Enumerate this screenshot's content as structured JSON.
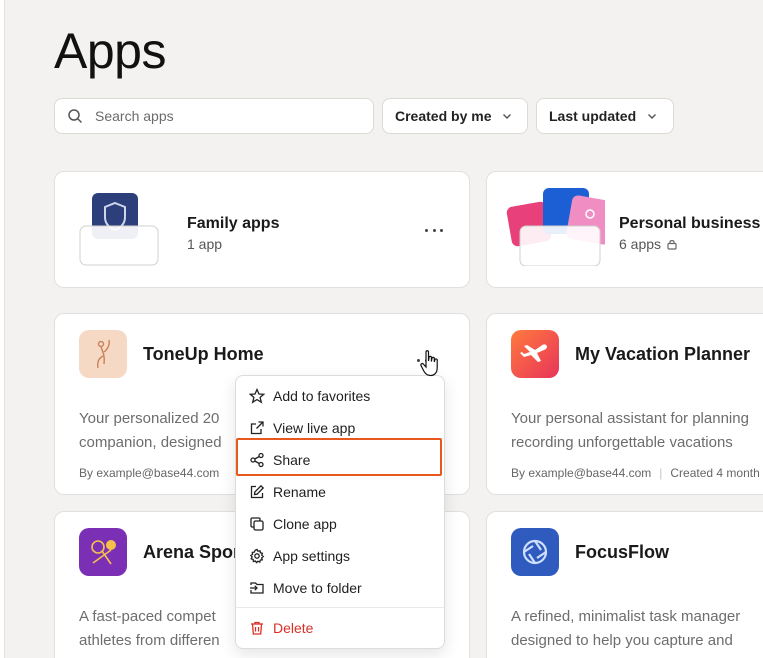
{
  "page": {
    "title": "Apps"
  },
  "filters": {
    "search_placeholder": "Search apps",
    "created_by": "Created by me",
    "sort": "Last updated"
  },
  "folders": [
    {
      "name": "Family apps",
      "count": "1 app",
      "locked": false
    },
    {
      "name": "Personal business",
      "count": "6 apps",
      "locked": true
    }
  ],
  "apps": [
    {
      "name": "ToneUp Home",
      "icon": "fitness-figure-icon",
      "icon_color": "#f6d9c4",
      "desc_lines": [
        "Your personalized 20",
        "companion, designed"
      ],
      "author": "By example@base44.com",
      "created": ""
    },
    {
      "name": "My Vacation Planner",
      "icon": "airplane-icon",
      "icon_color": "#f2553f",
      "desc_lines": [
        "Your personal assistant for planning",
        "recording unforgettable vacations"
      ],
      "author": "By example@base44.com",
      "created": "Created 4 month"
    },
    {
      "name": "Arena Spor",
      "icon": "sports-ball-icon",
      "icon_color": "#7b2fb5",
      "desc_lines": [
        "A fast-paced compet",
        "athletes from differen"
      ],
      "author": "",
      "created": ""
    },
    {
      "name": "FocusFlow",
      "icon": "aperture-icon",
      "icon_color": "#2f5bbf",
      "desc_lines": [
        "A refined, minimalist task manager",
        "designed to help you capture and"
      ],
      "author": "",
      "created": ""
    }
  ],
  "context_menu": {
    "items": [
      {
        "label": "Add to favorites",
        "icon": "star-icon"
      },
      {
        "label": "View live app",
        "icon": "external-link-icon"
      },
      {
        "label": "Share",
        "icon": "share-icon"
      },
      {
        "label": "Rename",
        "icon": "edit-icon"
      },
      {
        "label": "Clone app",
        "icon": "copy-icon"
      },
      {
        "label": "App settings",
        "icon": "gear-icon"
      },
      {
        "label": "Move to folder",
        "icon": "folder-move-icon"
      }
    ],
    "delete_label": "Delete",
    "highlighted": "Share",
    "highlight_color": "#e8581c",
    "danger_color": "#d93025"
  }
}
